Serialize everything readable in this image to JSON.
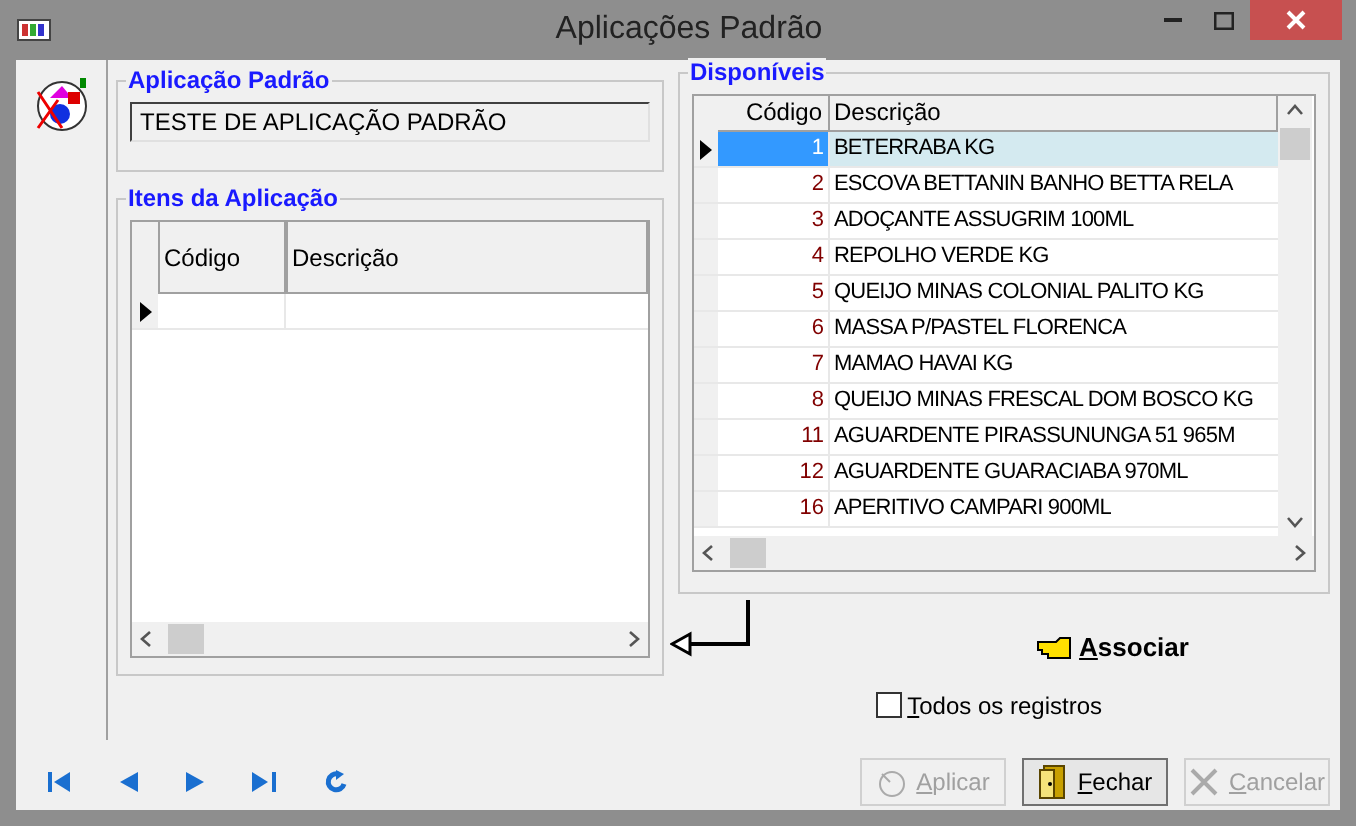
{
  "window": {
    "title": "Aplicações Padrão"
  },
  "aplicacao_padrao": {
    "label": "Aplicação Padrão",
    "value": "TESTE DE APLICAÇÃO PADRÃO"
  },
  "itens": {
    "label": "Itens da Aplicação",
    "columns": [
      "Código",
      "Descrição"
    ]
  },
  "disponiveis": {
    "label": "Disponíveis",
    "columns": [
      "Código",
      "Descrição"
    ],
    "rows": [
      {
        "codigo": "1",
        "descricao": "BETERRABA KG",
        "selected": true
      },
      {
        "codigo": "2",
        "descricao": "ESCOVA BETTANIN BANHO BETTA RELA",
        "selected": false
      },
      {
        "codigo": "3",
        "descricao": "ADOÇANTE ASSUGRIM 100ML",
        "selected": false
      },
      {
        "codigo": "4",
        "descricao": "REPOLHO VERDE KG",
        "selected": false
      },
      {
        "codigo": "5",
        "descricao": "QUEIJO MINAS COLONIAL PALITO KG",
        "selected": false
      },
      {
        "codigo": "6",
        "descricao": "MASSA P/PASTEL FLORENCA",
        "selected": false
      },
      {
        "codigo": "7",
        "descricao": "MAMAO HAVAI KG",
        "selected": false
      },
      {
        "codigo": "8",
        "descricao": "QUEIJO MINAS FRESCAL DOM BOSCO KG",
        "selected": false
      },
      {
        "codigo": "11",
        "descricao": "AGUARDENTE PIRASSUNUNGA 51 965M",
        "selected": false
      },
      {
        "codigo": "12",
        "descricao": "AGUARDENTE GUARACIABA 970ML",
        "selected": false
      },
      {
        "codigo": "16",
        "descricao": "APERITIVO CAMPARI 900ML",
        "selected": false
      }
    ]
  },
  "associar": {
    "label": "Associar"
  },
  "todos_registros": {
    "label": "Todos os registros",
    "checked": false
  },
  "buttons": [
    {
      "label": "Aplicar",
      "kind": "apply",
      "disabled": true
    },
    {
      "label": "Fechar",
      "kind": "close",
      "disabled": false
    },
    {
      "label": "Cancelar",
      "kind": "cancel",
      "disabled": true
    }
  ]
}
